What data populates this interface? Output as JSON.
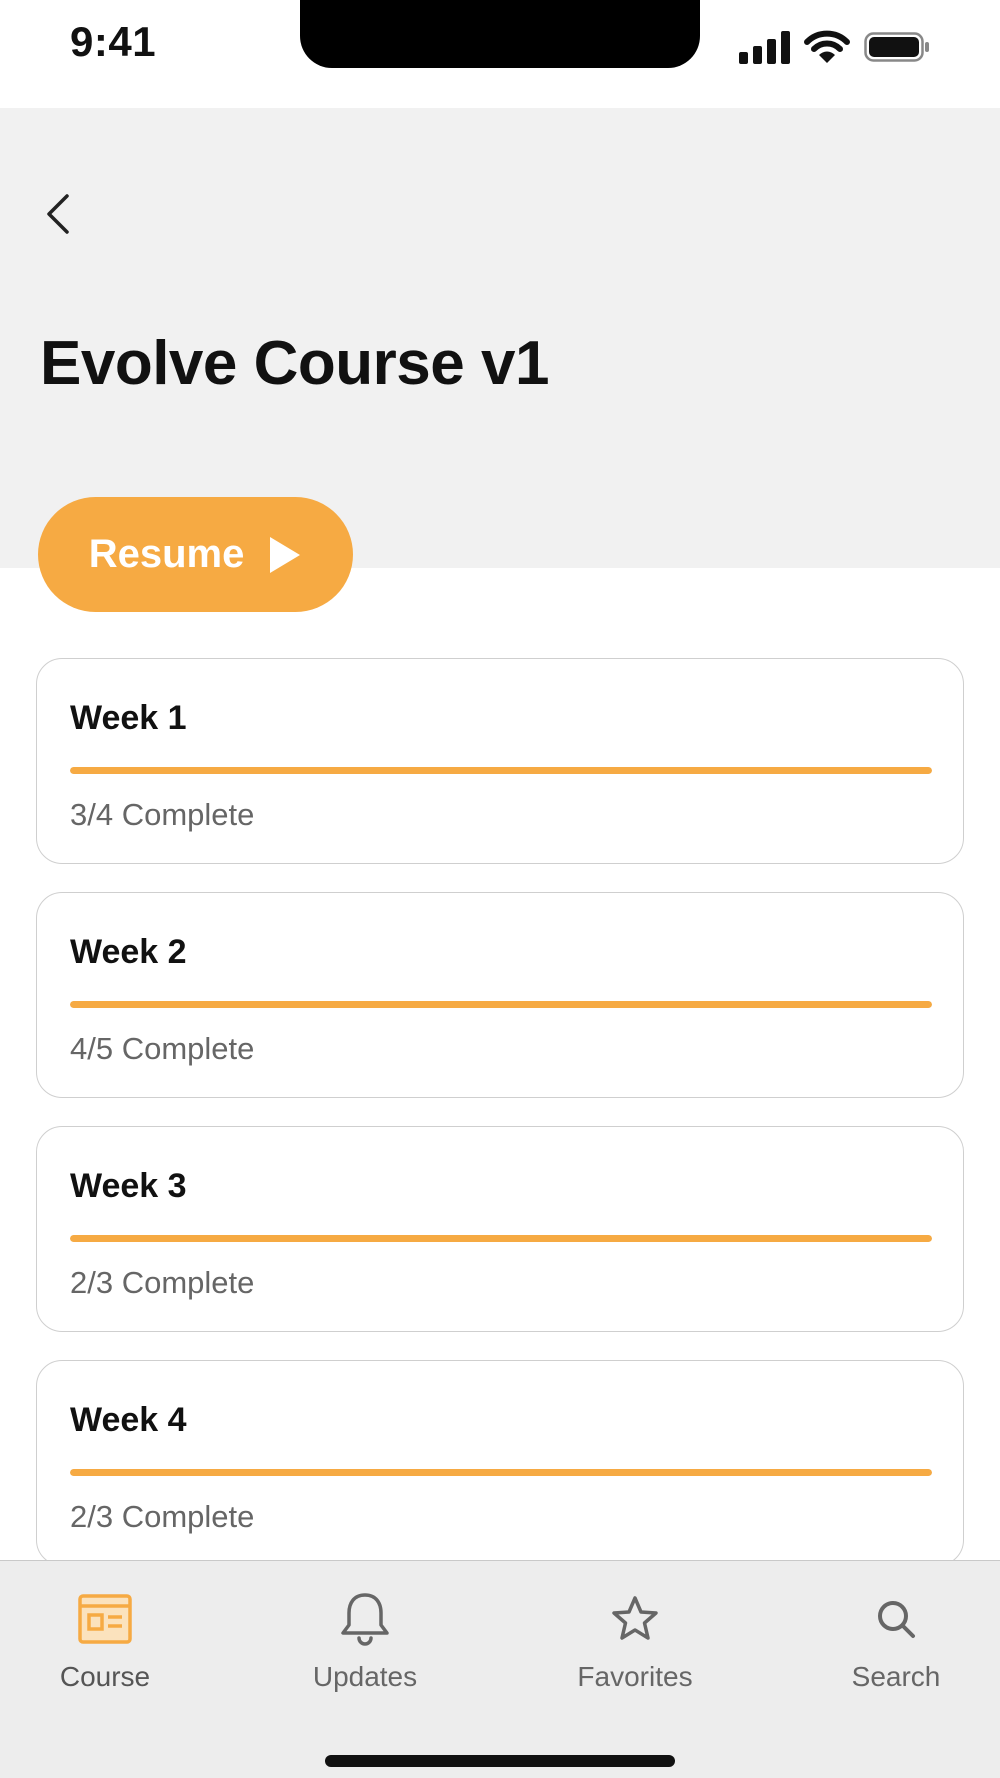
{
  "status_bar": {
    "time": "9:41",
    "icons": [
      "signal-icon",
      "wifi-icon",
      "battery-icon"
    ]
  },
  "header": {
    "back_icon": "chevron-left-icon",
    "title": "Evolve Course v1"
  },
  "resume": {
    "label": "Resume",
    "icon": "play-icon"
  },
  "weeks": [
    {
      "title": "Week 1",
      "status": "3/4 Complete",
      "progress": 1.0
    },
    {
      "title": "Week 2",
      "status": "4/5 Complete",
      "progress": 1.0
    },
    {
      "title": "Week 3",
      "status": "2/3 Complete",
      "progress": 1.0
    },
    {
      "title": "Week 4",
      "status": "2/3 Complete",
      "progress": 1.0
    }
  ],
  "tab_bar": {
    "active": "Course",
    "tabs": [
      {
        "label": "Course",
        "icon": "course-icon"
      },
      {
        "label": "Updates",
        "icon": "bell-icon"
      },
      {
        "label": "Favorites",
        "icon": "star-icon"
      },
      {
        "label": "Search",
        "icon": "search-icon"
      }
    ]
  },
  "colors": {
    "accent": "#f6aa43",
    "header_bg": "#f1f1f1",
    "tab_bar_bg": "#ededed",
    "muted_text": "#666666"
  }
}
